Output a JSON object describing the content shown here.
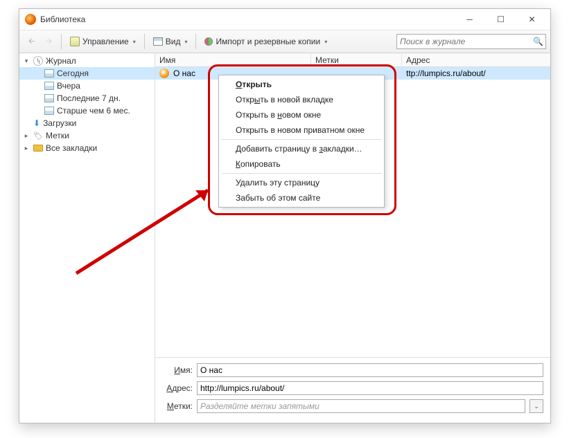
{
  "window": {
    "title": "Библиотека"
  },
  "toolbar": {
    "manage": "Управление",
    "view": "Вид",
    "import": "Импорт и резервные копии",
    "search_placeholder": "Поиск в журнале"
  },
  "tree": {
    "history": "Журнал",
    "today": "Сегодня",
    "yesterday": "Вчера",
    "last7": "Последние 7 дн.",
    "older6m": "Старше чем 6 мес.",
    "downloads": "Загрузки",
    "tags": "Метки",
    "all_bookmarks": "Все закладки"
  },
  "columns": {
    "name": "Имя",
    "tags": "Метки",
    "address": "Адрес"
  },
  "row": {
    "name": "О нас",
    "tags": "",
    "address": "ttp://lumpics.ru/about/"
  },
  "context": {
    "open": "ткрыть",
    "open_tab_pre": "Откр",
    "open_tab_u": "ы",
    "open_tab_post": "ть в новой вкладке",
    "open_win_pre": "Открыть в ",
    "open_win_u": "н",
    "open_win_post": "овом окне",
    "open_priv": "Открыть в новом приватном окне",
    "addbm_pre": "Добавить страницу в ",
    "addbm_u": "з",
    "addbm_post": "акладки…",
    "copy_u": "К",
    "copy_post": "опировать",
    "delete": "Удалить эту страницу",
    "forget": "Забыть об этом сайте"
  },
  "panel": {
    "name_u": "И",
    "name_label": "мя:",
    "addr_u": "А",
    "addr_label": "дрес:",
    "tags_u": "М",
    "tags_label": "етки:",
    "name_value": "О нас",
    "addr_value": "http://lumpics.ru/about/",
    "tags_placeholder": "Разделяйте метки запятыми"
  }
}
